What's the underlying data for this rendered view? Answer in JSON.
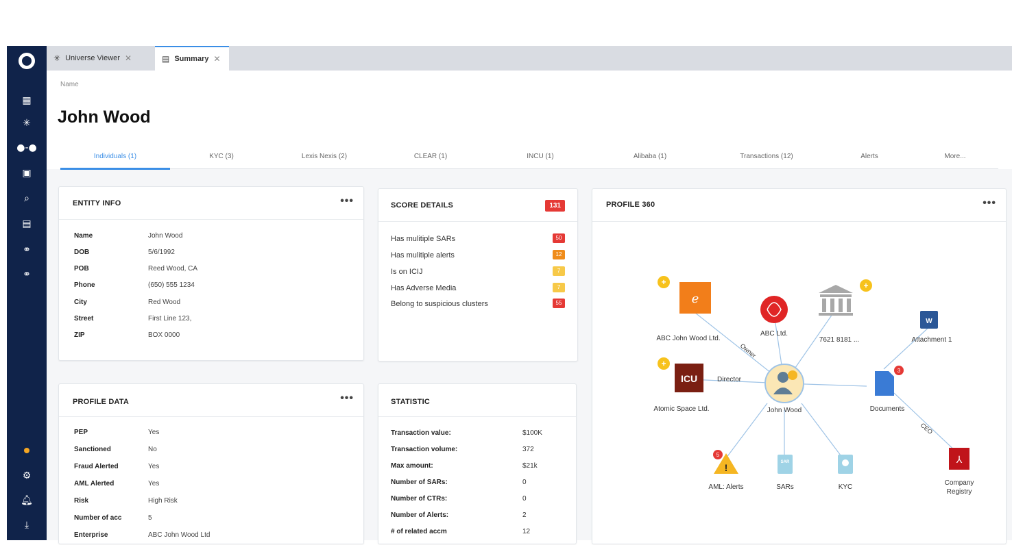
{
  "tabs": [
    {
      "label": "Universe Viewer",
      "icon": "network-icon"
    },
    {
      "label": "Summary",
      "icon": "table-icon"
    }
  ],
  "header": {
    "name_label": "Name",
    "person_name": "John Wood"
  },
  "subtabs": [
    "Individuals (1)",
    "KYC (3)",
    "Lexis Nexis (2)",
    "CLEAR (1)",
    "INCU (1)",
    "Alibaba (1)",
    "Transactions (12)",
    "Alerts",
    "More..."
  ],
  "entity_info": {
    "title": "ENTITY INFO",
    "rows": [
      {
        "k": "Name",
        "v": "John Wood"
      },
      {
        "k": "DOB",
        "v": "5/6/1992"
      },
      {
        "k": "POB",
        "v": "Reed Wood, CA"
      },
      {
        "k": "Phone",
        "v": "(650) 555 1234"
      },
      {
        "k": "City",
        "v": "Red Wood"
      },
      {
        "k": "Street",
        "v": "First Line 123,"
      },
      {
        "k": "ZIP",
        "v": "BOX 0000"
      }
    ]
  },
  "score_details": {
    "title": "SCORE DETAILS",
    "total": "131",
    "rows": [
      {
        "label": "Has mulitiple SARs",
        "score": "50",
        "color": "#e53935"
      },
      {
        "label": "Has mulitiple alerts",
        "score": "12",
        "color": "#f08c1a"
      },
      {
        "label": "Is on ICIJ",
        "score": "7",
        "color": "#f7c948"
      },
      {
        "label": "Has Adverse Media",
        "score": "7",
        "color": "#f7c948"
      },
      {
        "label": "Belong to suspicious clusters",
        "score": "55",
        "color": "#e53935"
      }
    ]
  },
  "profile_data": {
    "title": "PROFILE DATA",
    "rows": [
      {
        "k": "PEP",
        "v": "Yes"
      },
      {
        "k": "Sanctioned",
        "v": "No"
      },
      {
        "k": "Fraud Alerted",
        "v": "Yes"
      },
      {
        "k": "AML Alerted",
        "v": "Yes"
      },
      {
        "k": "Risk",
        "v": "High Risk"
      },
      {
        "k": "Number of acc",
        "v": "5"
      },
      {
        "k": "Enterprise",
        "v": "ABC John Wood Ltd"
      }
    ]
  },
  "statistic": {
    "title": "STATISTIC",
    "rows": [
      {
        "k": "Transaction value:",
        "v": "$100K"
      },
      {
        "k": "Transaction volume:",
        "v": "372"
      },
      {
        "k": "Max amount:",
        "v": "$21k"
      },
      {
        "k": "Number of SARs:",
        "v": "0"
      },
      {
        "k": "Number of CTRs:",
        "v": "0"
      },
      {
        "k": "Number of Alerts:",
        "v": "2"
      },
      {
        "k": "# of related accm",
        "v": "12"
      }
    ]
  },
  "profile360": {
    "title": "PROFILE 360",
    "center": "John Wood",
    "nodes": [
      {
        "label": "ABC John Wood Ltd."
      },
      {
        "label": "ABC Ltd."
      },
      {
        "label": "7621 8181 ..."
      },
      {
        "label": "Attachment 1"
      },
      {
        "label": "Atomic Space Ltd."
      },
      {
        "label": "Documents",
        "badge": "3"
      },
      {
        "label": "AML: Alerts",
        "badge": "5"
      },
      {
        "label": "SARs",
        "icon_text": "SAR"
      },
      {
        "label": "KYC"
      },
      {
        "label": "Company Registry"
      }
    ],
    "edge_labels": {
      "owner": "Owner",
      "director": "Director",
      "ceo": "CEO"
    },
    "icu_text": "ICU",
    "word_text": "W"
  },
  "colors": {
    "accent": "#3a8ee6",
    "sidebar": "#10234a",
    "danger": "#e53935"
  }
}
